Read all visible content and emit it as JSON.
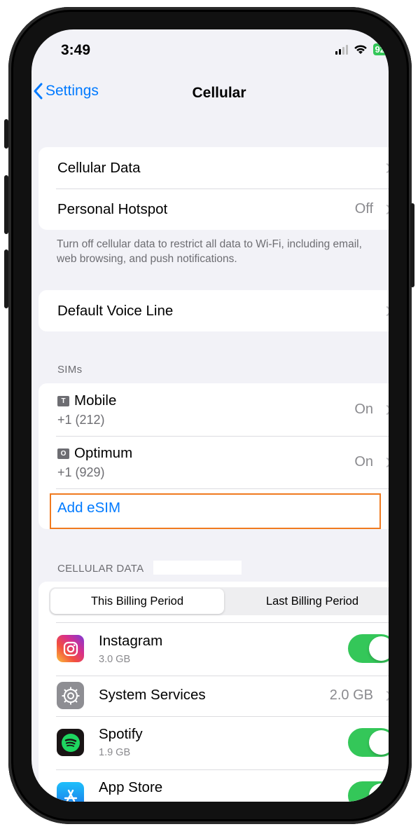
{
  "status_bar": {
    "time": "3:49",
    "battery": "92"
  },
  "nav": {
    "back_label": "Settings",
    "title": "Cellular"
  },
  "group1": {
    "rows": [
      {
        "label": "Cellular Data",
        "value": ""
      },
      {
        "label": "Personal Hotspot",
        "value": "Off"
      }
    ],
    "footnote": "Turn off cellular data to restrict all data to Wi-Fi, including email, web browsing, and push notifications."
  },
  "group2": {
    "rows": [
      {
        "label": "Default Voice Line"
      }
    ]
  },
  "sims": {
    "header": "SIMs",
    "items": [
      {
        "badge": "T",
        "name": "Mobile",
        "number": "+1 (212)",
        "status": "On"
      },
      {
        "badge": "O",
        "name": "Optimum",
        "number": "+1 (929)",
        "status": "On"
      }
    ],
    "add_esim_label": "Add eSIM"
  },
  "cellular_data": {
    "header": "CELLULAR DATA",
    "segments": [
      "This Billing Period",
      "Last Billing Period"
    ],
    "selected_segment": "This Billing Period",
    "apps": [
      {
        "name": "Instagram",
        "usage": "3.0 GB",
        "enabled": true,
        "icon": "instagram-icon"
      },
      {
        "name": "System Services",
        "value": "2.0 GB",
        "icon": "gear-icon"
      },
      {
        "name": "Spotify",
        "usage": "1.9 GB",
        "enabled": true,
        "icon": "spotify-icon"
      },
      {
        "name": "App Store",
        "enabled": true,
        "icon": "app-store-icon"
      }
    ]
  },
  "colors": {
    "accent": "#007aff",
    "toggle_on": "#34c759",
    "highlight": "#f07a1f",
    "background": "#f2f2f7"
  }
}
